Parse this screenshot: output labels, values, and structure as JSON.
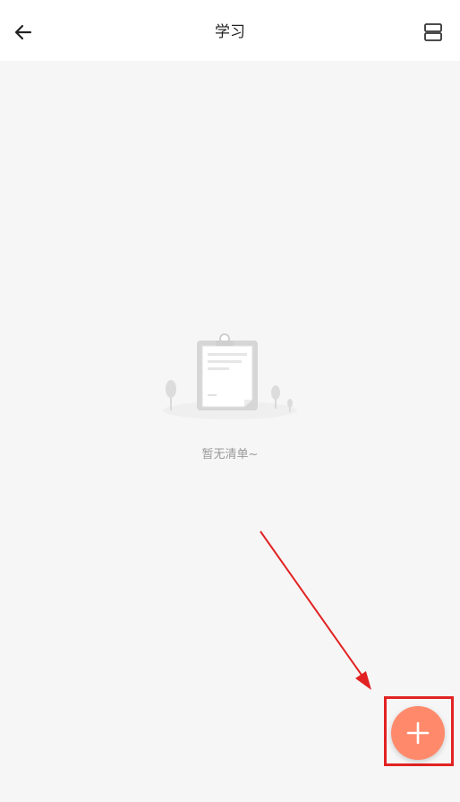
{
  "header": {
    "title": "学习",
    "back_icon": "arrow-left-icon",
    "layout_icon": "split-view-icon"
  },
  "empty_state": {
    "icon": "empty-clipboard-illustration",
    "message": "暂无清单~"
  },
  "fab": {
    "icon": "plus-icon",
    "color": "#ff8a6b"
  },
  "annotation": {
    "highlight_color": "#e22222"
  }
}
